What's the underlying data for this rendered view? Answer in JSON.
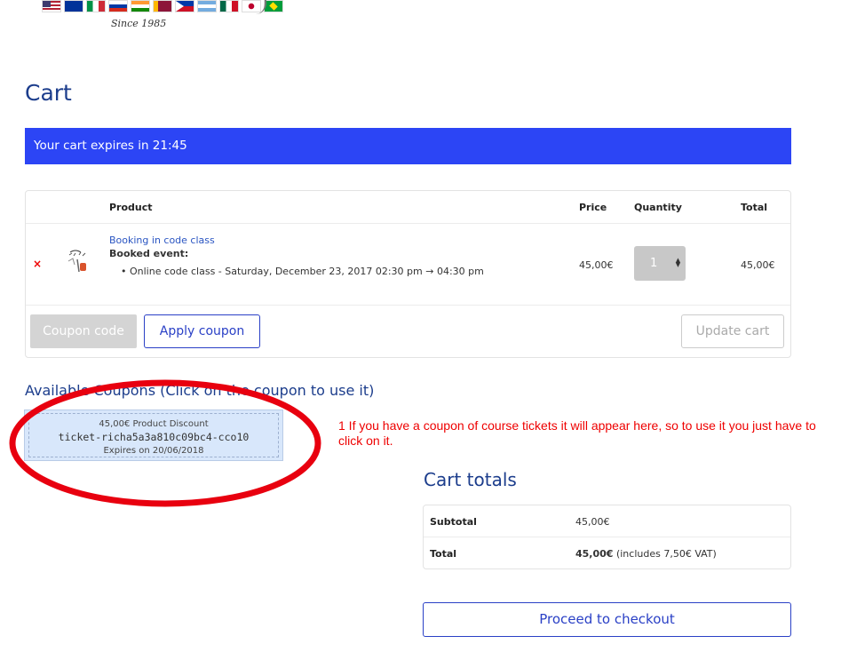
{
  "header": {
    "since": "Since 1985",
    "flags": [
      {
        "name": "usa",
        "colors": [
          "#b22234",
          "#ffffff",
          "#3c3b6e"
        ]
      },
      {
        "name": "eu",
        "colors": [
          "#003399",
          "#ffcc00"
        ]
      },
      {
        "name": "italy",
        "colors": [
          "#009246",
          "#ffffff",
          "#ce2b37"
        ]
      },
      {
        "name": "russia",
        "colors": [
          "#ffffff",
          "#0039a6",
          "#d52b1e"
        ]
      },
      {
        "name": "india",
        "colors": [
          "#ff9933",
          "#ffffff",
          "#138808"
        ]
      },
      {
        "name": "sri-lanka",
        "colors": [
          "#ffb700",
          "#8d153a"
        ]
      },
      {
        "name": "philippines",
        "colors": [
          "#0038a8",
          "#ce1126",
          "#ffffff"
        ]
      },
      {
        "name": "argentina",
        "colors": [
          "#74acdf",
          "#ffffff",
          "#74acdf"
        ]
      },
      {
        "name": "mexico",
        "colors": [
          "#006847",
          "#ffffff",
          "#ce1126"
        ]
      },
      {
        "name": "japan",
        "colors": [
          "#ffffff",
          "#bc002d"
        ]
      },
      {
        "name": "brazil",
        "colors": [
          "#009c3b",
          "#ffdf00"
        ]
      }
    ]
  },
  "page": {
    "title": "Cart"
  },
  "expire_bar": {
    "text": "Your cart expires in 21:45",
    "color": "#2c45f5"
  },
  "cart_table": {
    "columns": {
      "product": "Product",
      "price": "Price",
      "quantity": "Quantity",
      "total": "Total"
    },
    "row": {
      "remove": "×",
      "product_link": "Booking in code class",
      "booked_label": "Booked event:",
      "event": "Online code class - Saturday, December 23, 2017 02:30 pm → 04:30 pm",
      "price": "45,00€",
      "quantity": "1",
      "total": "45,00€"
    }
  },
  "actions": {
    "coupon_placeholder": "Coupon code",
    "apply_label": "Apply coupon",
    "update_label": "Update cart"
  },
  "coupons": {
    "title": "Available Coupons (Click on the coupon to use it)",
    "items": [
      {
        "line1": "45,00€ Product Discount",
        "code": "ticket-richa5a3a810c09bc4-cco10",
        "expires": "Expires on 20/06/2018"
      }
    ]
  },
  "annotation": {
    "text": "1 If you have a coupon of course tickets it will appear here, so to use it you just have to click on it.",
    "color": "#ee0000"
  },
  "totals": {
    "title": "Cart totals",
    "subtotal_label": "Subtotal",
    "subtotal_value": "45,00€",
    "total_label": "Total",
    "total_value": "45,00€",
    "total_note": "(includes 7,50€ VAT)"
  },
  "checkout": {
    "label": "Proceed to checkout"
  },
  "colors": {
    "accent": "#2a40c6",
    "heading": "#1c3d8c",
    "remove": "#ee0000"
  }
}
